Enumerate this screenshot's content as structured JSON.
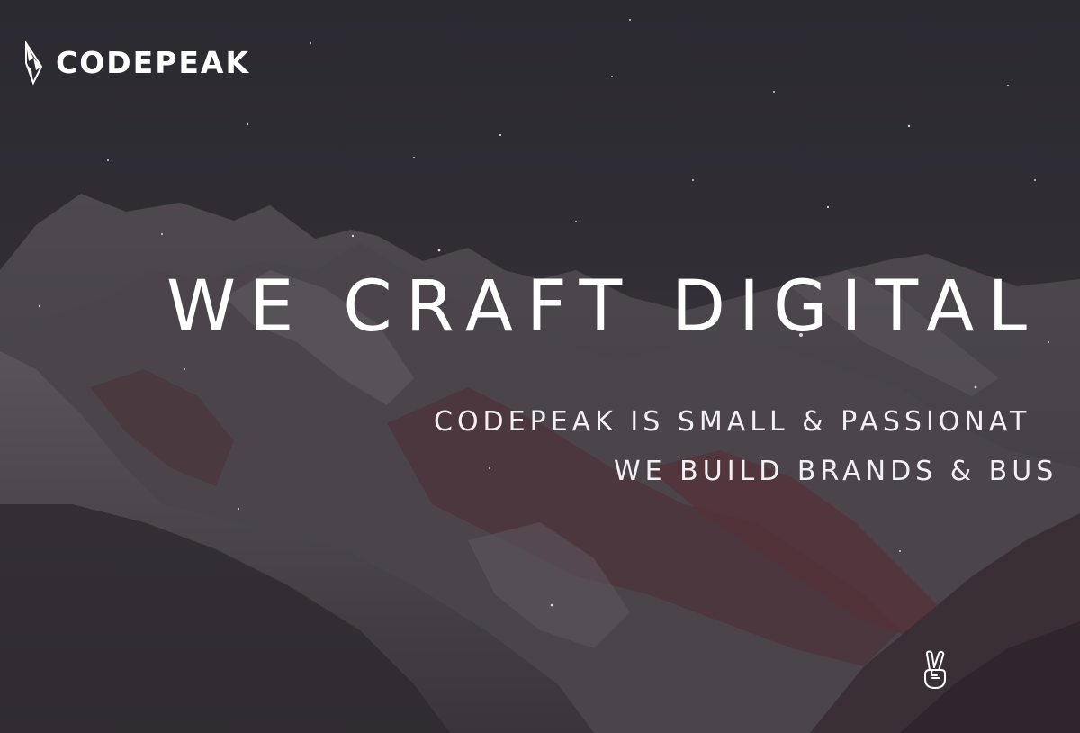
{
  "brand": {
    "name": "CODEPEAK",
    "logo_icon": "mountain-peak-icon"
  },
  "hero": {
    "headline": "WE CRAFT DIGITAL",
    "subtitle_line_1": "CODEPEAK IS SMALL & PASSIONAT",
    "subtitle_line_2": "WE BUILD BRANDS & BUS",
    "scroll_icon": "peace-hand-icon"
  },
  "colors": {
    "text": "#ffffff",
    "sky": "#2c2a31",
    "mountain_snow": "#5a5459",
    "rock_red": "#5c3038"
  }
}
